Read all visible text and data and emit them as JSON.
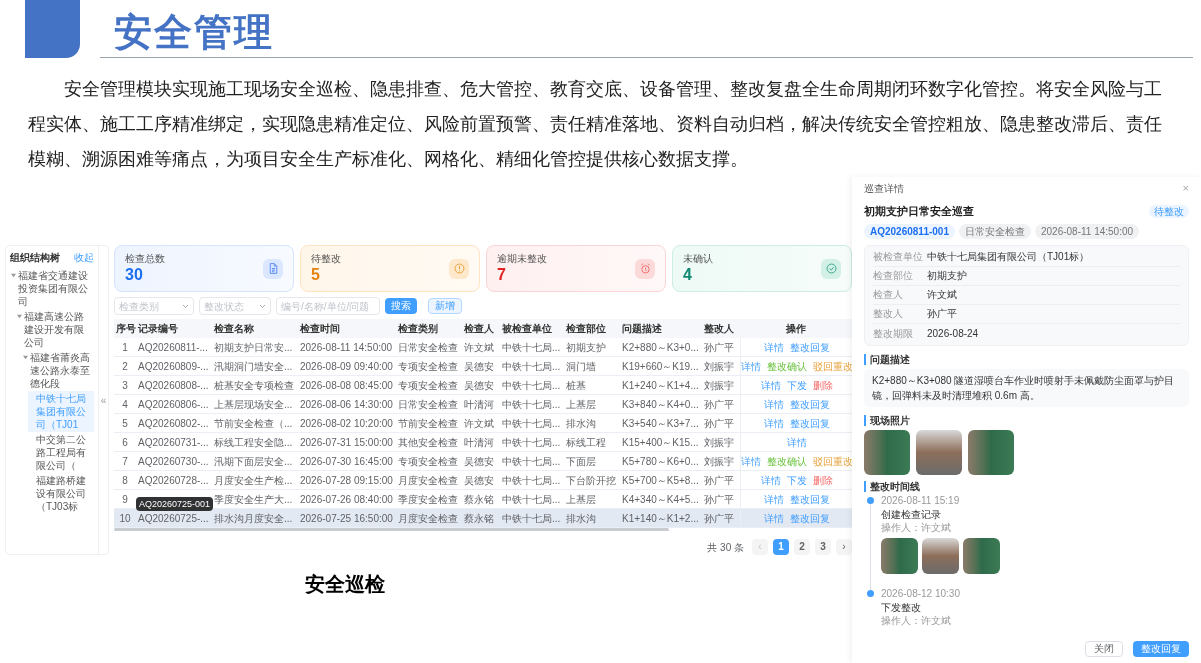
{
  "slide": {
    "title": "安全管理",
    "intro": "安全管理模块实现施工现场安全巡检、隐患排查、危大管控、教育交底、设备管理、整改复盘全生命周期闭环数字化管控。将安全风险与工程实体、施工工序精准绑定，实现隐患精准定位、风险前置预警、责任精准落地、资料自动归档，解决传统安全管控粗放、隐患整改滞后、责任模糊、溯源困难等痛点，为项目安全生产标准化、网格化、精细化管控提供核心数据支撑。",
    "caption": "安全巡检"
  },
  "app": {
    "tree": {
      "title": "组织结构树",
      "collapse": "收起",
      "items": [
        {
          "label": "福建省交通建设投资集团有限公司",
          "expanded": true,
          "selected": false,
          "children": [
            {
              "label": "福建高速公路建设开发有限公司",
              "expanded": true,
              "selected": false,
              "children": [
                {
                  "label": "福建省莆炎高速公路永泰至德化段",
                  "expanded": true,
                  "selected": false,
                  "children": [
                    {
                      "label": "中铁十七局集团有限公司（TJ01",
                      "selected": true
                    },
                    {
                      "label": "中交第二公路工程局有限公司（",
                      "selected": false
                    },
                    {
                      "label": "福建路桥建设有限公司（TJ03标",
                      "selected": false
                    }
                  ]
                }
              ]
            }
          ]
        }
      ]
    },
    "collapse_toggle": "«",
    "stats": [
      {
        "label": "检查总数",
        "value": "30",
        "kind": "total"
      },
      {
        "label": "待整改",
        "value": "5",
        "kind": "pending"
      },
      {
        "label": "逾期未整改",
        "value": "7",
        "kind": "overdue"
      },
      {
        "label": "未确认",
        "value": "4",
        "kind": "unconfirmed"
      }
    ],
    "filters": {
      "category": {
        "placeholder": "检查类别"
      },
      "status": {
        "placeholder": "整改状态"
      },
      "search": {
        "placeholder": "编号/名称/单位/问题"
      },
      "search_button": "搜索",
      "add_button": "新增"
    },
    "table": {
      "columns": [
        "序号",
        "记录编号",
        "检查名称",
        "检查时间",
        "检查类别",
        "检查人",
        "被检查单位",
        "检查部位",
        "问题描述",
        "整改人",
        "操作"
      ],
      "rows": [
        {
          "no": "1",
          "record": "AQ20260811-...",
          "name": "初期支护日常安...",
          "time": "2026-08-11 14:50:00",
          "category": "日常安全检查",
          "inspector": "许文斌",
          "unit": "中铁十七局...",
          "location": "初期支护",
          "issue": "K2+880～K3+0...",
          "rectifier": "孙广平",
          "highlighted": false,
          "actions": [
            {
              "label": "详情",
              "kind": "detail"
            },
            {
              "label": "整改回复",
              "kind": "reply"
            }
          ]
        },
        {
          "no": "2",
          "record": "AQ20260809-...",
          "name": "汛期洞门墙安全...",
          "time": "2026-08-09 09:40:00",
          "category": "专项安全检查",
          "inspector": "吴德安",
          "unit": "中铁十七局...",
          "location": "洞门墙",
          "issue": "K19+660～K19...",
          "rectifier": "刘振宇",
          "highlighted": false,
          "actions": [
            {
              "label": "详情",
              "kind": "detail"
            },
            {
              "label": "整改确认",
              "kind": "confirm"
            },
            {
              "label": "驳回重改",
              "kind": "reject"
            }
          ]
        },
        {
          "no": "3",
          "record": "AQ20260808-...",
          "name": "桩基安全专项检查",
          "time": "2026-08-08 08:45:00",
          "category": "专项安全检查",
          "inspector": "吴德安",
          "unit": "中铁十七局...",
          "location": "桩基",
          "issue": "K1+240～K1+4...",
          "rectifier": "刘振宇",
          "highlighted": false,
          "actions": [
            {
              "label": "详情",
              "kind": "detail"
            },
            {
              "label": "下发",
              "kind": "issue"
            },
            {
              "label": "删除",
              "kind": "delete"
            }
          ]
        },
        {
          "no": "4",
          "record": "AQ20260806-...",
          "name": "上基层现场安全...",
          "time": "2026-08-06 14:30:00",
          "category": "日常安全检查",
          "inspector": "叶清河",
          "unit": "中铁十七局...",
          "location": "上基层",
          "issue": "K3+840～K4+0...",
          "rectifier": "孙广平",
          "highlighted": false,
          "actions": [
            {
              "label": "详情",
              "kind": "detail"
            },
            {
              "label": "整改回复",
              "kind": "reply"
            }
          ]
        },
        {
          "no": "5",
          "record": "AQ20260802-...",
          "name": "节前安全检查（...",
          "time": "2026-08-02 10:20:00",
          "category": "节前安全检查",
          "inspector": "许文斌",
          "unit": "中铁十七局...",
          "location": "排水沟",
          "issue": "K3+540～K3+7...",
          "rectifier": "孙广平",
          "highlighted": false,
          "actions": [
            {
              "label": "详情",
              "kind": "detail"
            },
            {
              "label": "整改回复",
              "kind": "reply"
            }
          ]
        },
        {
          "no": "6",
          "record": "AQ20260731-...",
          "name": "标线工程安全隐...",
          "time": "2026-07-31 15:00:00",
          "category": "其他安全检查",
          "inspector": "叶清河",
          "unit": "中铁十七局...",
          "location": "标线工程",
          "issue": "K15+400～K15...",
          "rectifier": "刘振宇",
          "highlighted": false,
          "actions": [
            {
              "label": "详情",
              "kind": "detail"
            }
          ]
        },
        {
          "no": "7",
          "record": "AQ20260730-...",
          "name": "汛期下面层安全...",
          "time": "2026-07-30 16:45:00",
          "category": "专项安全检查",
          "inspector": "吴德安",
          "unit": "中铁十七局...",
          "location": "下面层",
          "issue": "K5+780～K6+0...",
          "rectifier": "刘振宇",
          "highlighted": false,
          "actions": [
            {
              "label": "详情",
              "kind": "detail"
            },
            {
              "label": "整改确认",
              "kind": "confirm"
            },
            {
              "label": "驳回重改",
              "kind": "reject"
            }
          ]
        },
        {
          "no": "8",
          "record": "AQ20260728-...",
          "name": "月度安全生产检...",
          "time": "2026-07-28 09:15:00",
          "category": "月度安全检查",
          "inspector": "吴德安",
          "unit": "中铁十七局...",
          "location": "下台阶开挖",
          "issue": "K5+700～K5+8...",
          "rectifier": "孙广平",
          "highlighted": false,
          "actions": [
            {
              "label": "详情",
              "kind": "detail"
            },
            {
              "label": "下发",
              "kind": "issue"
            },
            {
              "label": "删除",
              "kind": "delete"
            }
          ]
        },
        {
          "no": "9",
          "name": "季度安全生产大...",
          "time": "2026-07-26 08:40:00",
          "category": "季度安全检查",
          "inspector": "蔡永铭",
          "unit": "中铁十七局...",
          "location": "上基层",
          "issue": "K4+340～K4+5...",
          "rectifier": "孙广平",
          "highlighted": false,
          "actions": [
            {
              "label": "详情",
              "kind": "detail"
            },
            {
              "label": "整改回复",
              "kind": "reply"
            }
          ]
        },
        {
          "no": "10",
          "record": "AQ20260725-...",
          "tooltip": "AQ20260725-001",
          "name": "排水沟月度安全...",
          "time": "2026-07-25 16:50:00",
          "category": "月度安全检查",
          "inspector": "蔡永铭",
          "unit": "中铁十七局...",
          "location": "排水沟",
          "issue": "K1+140～K1+2...",
          "rectifier": "孙广平",
          "highlighted": true,
          "actions": [
            {
              "label": "详情",
              "kind": "detail"
            },
            {
              "label": "整改回复",
              "kind": "reply"
            }
          ]
        }
      ]
    },
    "pagination": {
      "total": "共 30 条",
      "prev": "‹",
      "next": "›",
      "pages": [
        {
          "label": "1",
          "selected": true
        },
        {
          "label": "2",
          "selected": false
        },
        {
          "label": "3",
          "selected": false
        }
      ]
    }
  },
  "detail": {
    "title": "巡查详情",
    "close": "×",
    "name": "初期支护日常安全巡查",
    "status": "待整改",
    "tags": [
      {
        "text": "AQ20260811-001",
        "kind": "id"
      },
      {
        "text": "日常安全检查",
        "kind": "plain"
      },
      {
        "text": "2026-08-11 14:50:00",
        "kind": "plain"
      }
    ],
    "fields": [
      {
        "label": "被检查单位",
        "value": "中铁十七局集团有限公司（TJ01标）"
      },
      {
        "label": "检查部位",
        "value": "初期支护"
      },
      {
        "label": "检查人",
        "value": "许文斌"
      },
      {
        "label": "整改人",
        "value": "孙广平"
      },
      {
        "label": "整改期限",
        "value": "2026-08-24"
      }
    ],
    "problem_heading": "问题描述",
    "problem": "K2+880～K3+080 隧道湿喷台车作业时喷射手未佩戴防尘面罩与护目镜，回弹料未及时清理堆积 0.6m 高。",
    "photos_heading": "现场照片",
    "photos": [
      {
        "kind": "site"
      },
      {
        "kind": "meeting"
      },
      {
        "kind": "site"
      }
    ],
    "timeline_heading": "整改时间线",
    "timeline": [
      {
        "time": "2026-08-11 15:19",
        "title": "创建检查记录",
        "operator": "操作人：许文斌",
        "photos": [
          {
            "kind": "site"
          },
          {
            "kind": "meeting"
          },
          {
            "kind": "site"
          }
        ]
      },
      {
        "time": "2026-08-12 10:30",
        "title": "下发整改",
        "operator": "操作人：许文斌"
      }
    ],
    "buttons": [
      {
        "label": "关闭",
        "kind": "secondary"
      },
      {
        "label": "整改回复",
        "kind": "primary"
      }
    ]
  }
}
